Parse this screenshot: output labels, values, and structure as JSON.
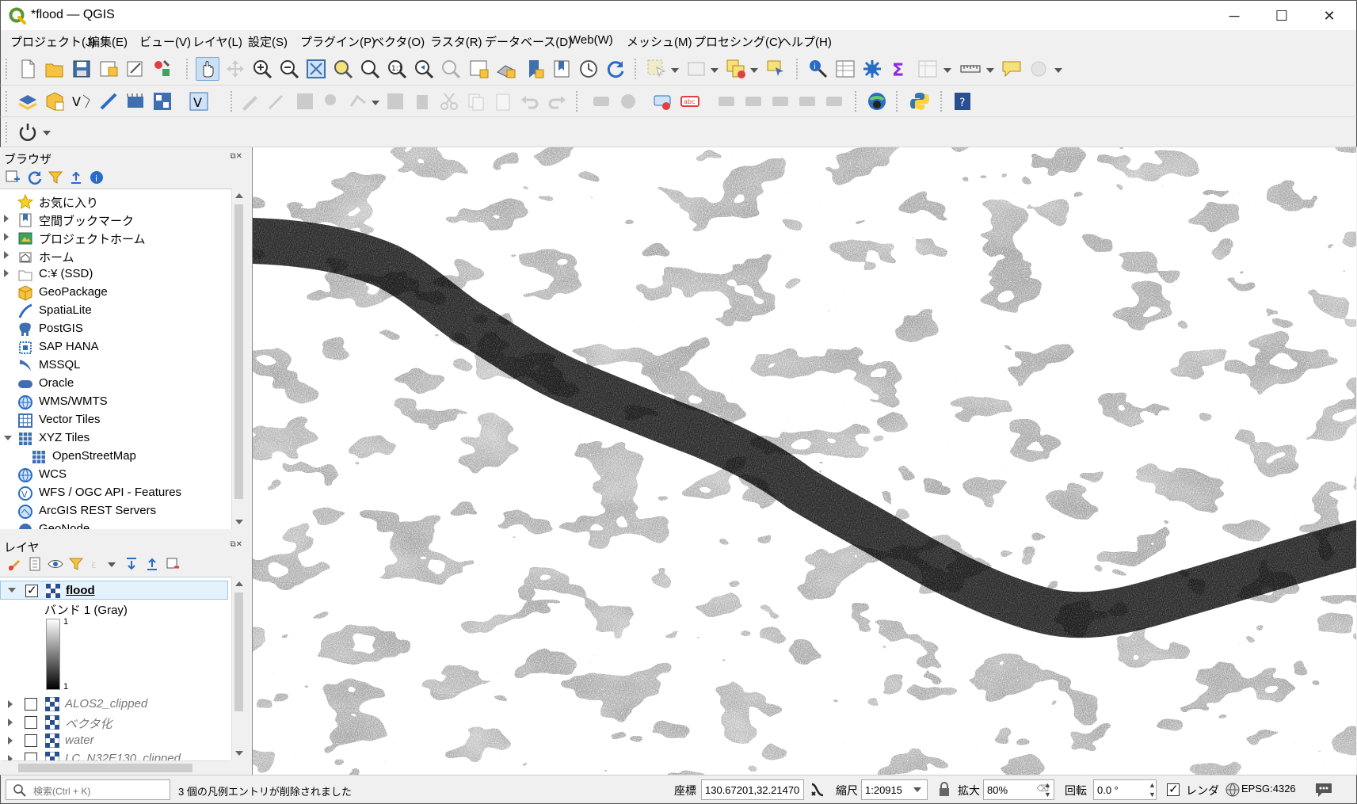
{
  "window": {
    "title": "*flood — QGIS",
    "minimize": "─",
    "maximize": "☐",
    "close": "✕"
  },
  "menu": [
    "プロジェクト(J)",
    "編集(E)",
    "ビュー(V)",
    "レイヤ(L)",
    "設定(S)",
    "プラグイン(P)",
    "ベクタ(O)",
    "ラスタ(R)",
    "データベース(D)",
    "Web(W)",
    "メッシュ(M)",
    "プロセシング(C)",
    "ヘルプ(H)"
  ],
  "browser_panel": {
    "title": "ブラウザ",
    "items": [
      {
        "label": "お気に入り",
        "icon": "star-icon",
        "expandable": false,
        "indent": 0
      },
      {
        "label": "空間ブックマーク",
        "icon": "bookmark-icon",
        "expandable": true,
        "indent": 0
      },
      {
        "label": "プロジェクトホーム",
        "icon": "project-home-icon",
        "expandable": true,
        "indent": 0
      },
      {
        "label": "ホーム",
        "icon": "home-icon",
        "expandable": true,
        "indent": 0
      },
      {
        "label": "C:¥ (SSD)",
        "icon": "drive-icon",
        "expandable": true,
        "indent": 0
      },
      {
        "label": "GeoPackage",
        "icon": "geopackage-icon",
        "expandable": false,
        "indent": 0
      },
      {
        "label": "SpatiaLite",
        "icon": "spatialite-icon",
        "expandable": false,
        "indent": 0
      },
      {
        "label": "PostGIS",
        "icon": "postgis-icon",
        "expandable": false,
        "indent": 0
      },
      {
        "label": "SAP HANA",
        "icon": "hana-icon",
        "expandable": false,
        "indent": 0
      },
      {
        "label": "MSSQL",
        "icon": "mssql-icon",
        "expandable": false,
        "indent": 0
      },
      {
        "label": "Oracle",
        "icon": "oracle-icon",
        "expandable": false,
        "indent": 0
      },
      {
        "label": "WMS/WMTS",
        "icon": "wms-icon",
        "expandable": false,
        "indent": 0
      },
      {
        "label": "Vector Tiles",
        "icon": "vector-tiles-icon",
        "expandable": false,
        "indent": 0
      },
      {
        "label": "XYZ Tiles",
        "icon": "xyz-tiles-icon",
        "expandable": true,
        "expanded": true,
        "indent": 0
      },
      {
        "label": "OpenStreetMap",
        "icon": "xyz-tiles-icon",
        "expandable": false,
        "indent": 1
      },
      {
        "label": "WCS",
        "icon": "wcs-icon",
        "expandable": false,
        "indent": 0
      },
      {
        "label": "WFS / OGC API - Features",
        "icon": "wfs-icon",
        "expandable": false,
        "indent": 0
      },
      {
        "label": "ArcGIS REST Servers",
        "icon": "arcgis-icon",
        "expandable": false,
        "indent": 0
      },
      {
        "label": "GeoNode",
        "icon": "geonode-icon",
        "expandable": false,
        "indent": 0
      }
    ]
  },
  "layers_panel": {
    "title": "レイヤ",
    "active_layer": {
      "name": "flood",
      "checked": true
    },
    "band_label": "バンド 1 (Gray)",
    "legend_max": "1",
    "legend_min": "1",
    "layers": [
      {
        "name": "ALOS2_clipped",
        "checked": false
      },
      {
        "name": "ベクタ化",
        "checked": false
      },
      {
        "name": "water",
        "checked": false
      },
      {
        "name": "LC_N32E130_clipped",
        "checked": false
      }
    ]
  },
  "statusbar": {
    "search_placeholder": "検索(Ctrl + K)",
    "message": "3 個の凡例エントリが削除されました",
    "coord_label": "座標",
    "coord_value": "130.67201,32.21470",
    "scale_label": "縮尺",
    "scale_value": "1:20915",
    "magnifier_label": "拡大",
    "magnifier_value": "80%",
    "rotation_label": "回転",
    "rotation_value": "0.0 °",
    "render_label": "レンダ",
    "render_checked": true,
    "crs": "EPSG:4326"
  },
  "colors": {
    "qgis_green": "#589632",
    "qgis_yellow": "#f0b400",
    "selection_bg": "#cce8ff"
  }
}
